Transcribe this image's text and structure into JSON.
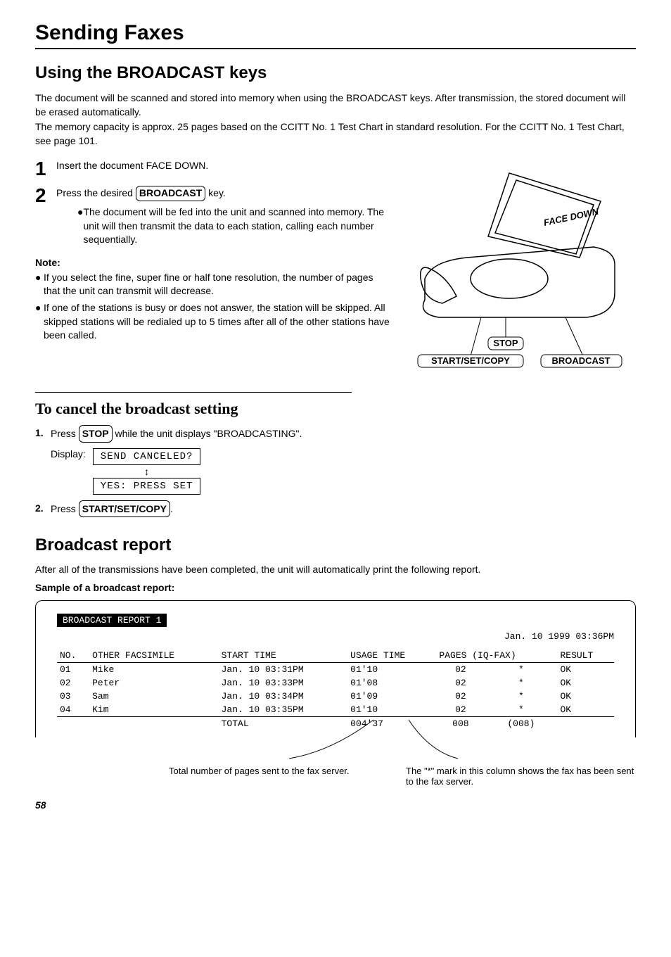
{
  "page_title": "Sending Faxes",
  "section1": {
    "heading": "Using the BROADCAST keys",
    "intro1": "The document will be scanned and stored into memory when using the BROADCAST keys. After transmission, the stored document will be erased automatically.",
    "intro2": "The memory capacity is approx. 25 pages based on the CCITT No. 1 Test Chart in standard resolution. For the CCITT No. 1 Test Chart, see page 101.",
    "step1_num": "1",
    "step1_text": "Insert the document FACE DOWN.",
    "step2_num": "2",
    "step2_pre": "Press the desired ",
    "step2_btn": "BROADCAST",
    "step2_post": " key.",
    "step2_bullet": "The document will be fed into the unit and scanned into memory. The unit will then transmit the data to each station, calling each number sequentially.",
    "note_heading": "Note:",
    "note1": "If you select the fine, super fine or half tone resolution, the number of pages that the unit can transmit will decrease.",
    "note2": "If one of the stations is busy or does not answer, the station will be skipped. All skipped stations will be redialed up to 5 times after all of the other stations have been called."
  },
  "illustration": {
    "face_down": "FACE DOWN",
    "stop": "STOP",
    "start_set_copy": "START/SET/COPY",
    "broadcast": "BROADCAST"
  },
  "cancel": {
    "heading": "To cancel the broadcast setting",
    "step1_n": "1.",
    "step1_pre": "Press ",
    "step1_btn": "STOP",
    "step1_post": " while the unit displays \"BROADCASTING\".",
    "display_label": "Display:",
    "lcd1": "SEND CANCELED?",
    "lcd2": "YES: PRESS SET",
    "step2_n": "2.",
    "step2_pre": "Press ",
    "step2_btn": "START/SET/COPY",
    "step2_post": "."
  },
  "report": {
    "heading": "Broadcast report",
    "intro": "After all of the transmissions have been completed, the unit will automatically print the following report.",
    "sample_label": "Sample of a broadcast report:",
    "title": "BROADCAST REPORT 1",
    "date": "Jan. 10 1999 03:36PM",
    "headers": {
      "no": "NO.",
      "other": "OTHER FACSIMILE",
      "start": "START TIME",
      "usage": "USAGE TIME",
      "pages": "PAGES (IQ-FAX)",
      "result": "RESULT"
    },
    "rows": [
      {
        "no": "01",
        "other": "Mike",
        "start": "Jan. 10 03:31PM",
        "usage": "01'10",
        "pages": "02",
        "iq": "*",
        "result": "OK"
      },
      {
        "no": "02",
        "other": "Peter",
        "start": "Jan. 10 03:33PM",
        "usage": "01'08",
        "pages": "02",
        "iq": "*",
        "result": "OK"
      },
      {
        "no": "03",
        "other": "Sam",
        "start": "Jan. 10 03:34PM",
        "usage": "01'09",
        "pages": "02",
        "iq": "*",
        "result": "OK"
      },
      {
        "no": "04",
        "other": "Kim",
        "start": "Jan. 10 03:35PM",
        "usage": "01'10",
        "pages": "02",
        "iq": "*",
        "result": "OK"
      }
    ],
    "total_label": "TOTAL",
    "total_usage": "004'37",
    "total_pages": "008",
    "total_iq": "(008)",
    "anno_left": "Total number of pages sent to the fax server.",
    "anno_right": "The \"*\" mark in this column shows the fax has been sent to the fax server."
  },
  "page_number": "58"
}
